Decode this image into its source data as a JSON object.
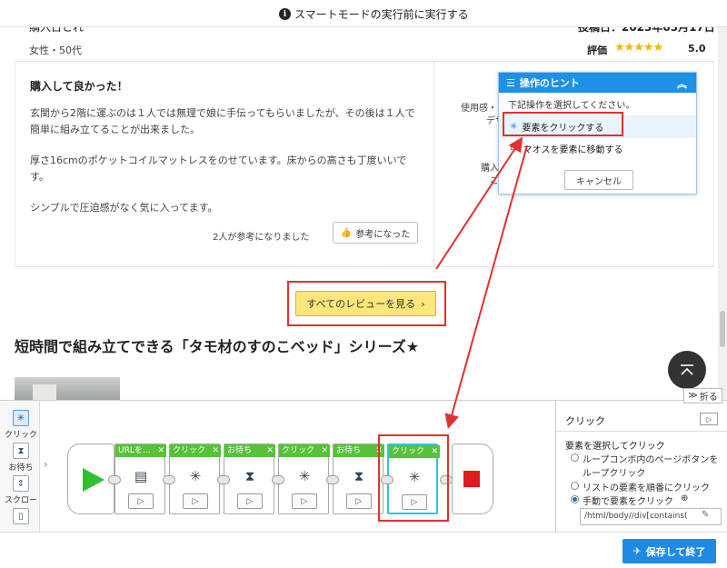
{
  "notice_bar": {
    "message": "スマートモードの実行前に実行する",
    "icon": "info-icon"
  },
  "review": {
    "author_cut": "購入日とれ",
    "date_cut": "投稿日：2023年03月17日",
    "demographic": "女性・50代",
    "rating_label": "評価",
    "stars": "★★★★★",
    "rating_value": "5.0",
    "title": "購入して良かった！",
    "body_1a": "玄関から2階に運ぶのは１人では無理で娘に手伝ってもらいましたが、その後は１人で",
    "body_1b": "簡単に組み立てることが出来ました。",
    "body_2a": "厚さ16cmのポケットコイルマットレスをのせています。床からの高さも丁度いいで",
    "body_2b": "す。",
    "body_3": "シンプルで圧迫感がなく気に入ってます。",
    "helpful_count": "2人が参考になりました",
    "helpful_button": "参考になった",
    "side_label_1": "使用感・",
    "side_label_2": "デザ",
    "side_label_3": "購入",
    "side_label_4": "ご"
  },
  "all_reviews_button": "すべてのレビューを見る",
  "series_title": "短時間で組み立てできる「タモ材のすのこベッド」シリーズ★",
  "hint_popup": {
    "title": "操作のヒント",
    "subtitle": "下記操作を選択してください。",
    "option_click": "要素をクリックする",
    "option_hover": "マオスを要素に移動する",
    "cancel": "キャンセル"
  },
  "collapse_button": "折る",
  "toolbox": [
    {
      "label": "クリック",
      "icon": "cursor-click-icon"
    },
    {
      "label": "お待ち",
      "icon": "hourglass-icon"
    },
    {
      "label": "スクロール",
      "icon": "scroll-icon"
    }
  ],
  "workflow_steps": [
    {
      "label": "URLを...",
      "icon": "open-url-icon"
    },
    {
      "label": "クリック",
      "icon": "cursor-click-icon"
    },
    {
      "label": "お待ち",
      "icon": "hourglass-icon"
    },
    {
      "label": "クリック",
      "icon": "cursor-click-icon"
    },
    {
      "label": "お待ち",
      "icon": "hourglass-icon"
    },
    {
      "label": "クリック",
      "icon": "cursor-click-icon",
      "selected": true
    }
  ],
  "properties": {
    "title": "クリック",
    "section_label": "要素を選択してクリック",
    "option_1a": "ループコンボ内のページボタンを",
    "option_1b": "ループクリック",
    "option_2": "リストの要素を順番にクリック",
    "option_3": "手動で要素をクリック",
    "xpath": "/html/body//div[contains("
  },
  "save_button": "保存して終了",
  "colors": {
    "accent": "#1e8ae6",
    "highlight": "#e23030",
    "step_tab": "#56c23a",
    "selected_step": "#2dc6d6",
    "star": "#f5b400"
  }
}
